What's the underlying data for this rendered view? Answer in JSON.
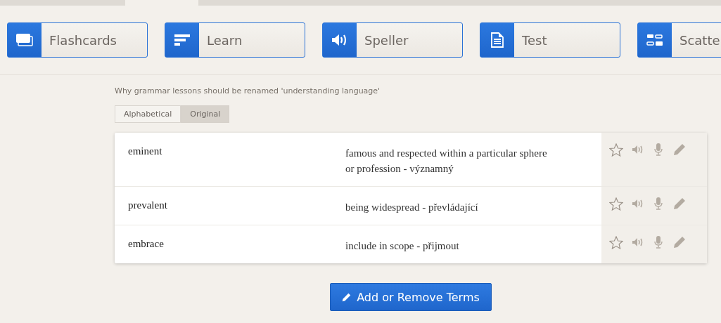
{
  "modes": [
    {
      "kind": "flashcards",
      "label": "Flashcards"
    },
    {
      "kind": "learn",
      "label": "Learn"
    },
    {
      "kind": "speller",
      "label": "Speller"
    },
    {
      "kind": "test",
      "label": "Test"
    },
    {
      "kind": "scatter",
      "label": "Scatte"
    }
  ],
  "set_title": "Why grammar lessons should be renamed 'understanding language'",
  "sort_options": [
    {
      "label": "Alphabetical",
      "selected": false
    },
    {
      "label": "Original",
      "selected": true
    }
  ],
  "terms": [
    {
      "term": "eminent",
      "definition": "famous and respected within a particular sphere or profession - významný",
      "starred": false
    },
    {
      "term": "prevalent",
      "definition": "being widespread - převládající",
      "starred": false
    },
    {
      "term": "embrace",
      "definition": "include in scope - přijmout",
      "starred": false
    }
  ],
  "edit_button": "Add or Remove Terms"
}
